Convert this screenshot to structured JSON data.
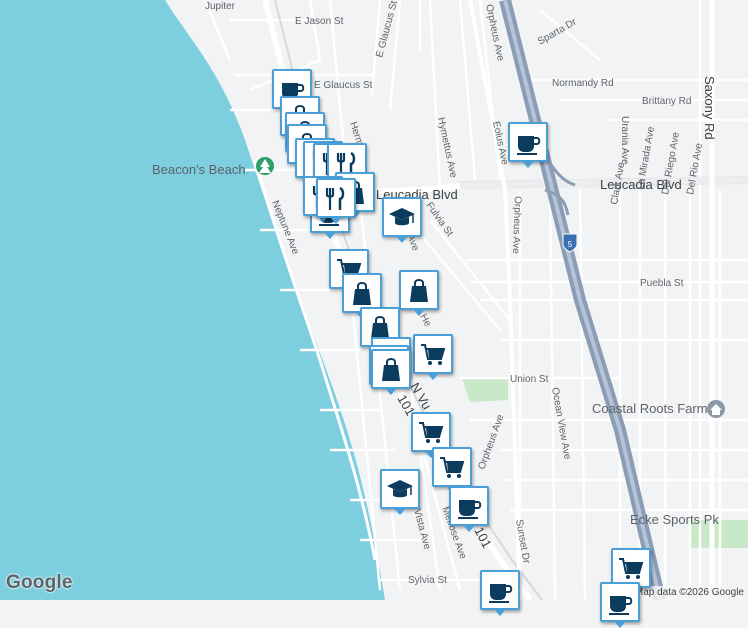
{
  "map": {
    "attribution": "Map data ©2026 Google",
    "logo_text": "Google",
    "colors": {
      "water": "#7dcfe0",
      "land": "#f1f3f4",
      "road": "#ffffff",
      "freeway": "#8a9db5",
      "park": "#c9e8c8",
      "marker_border": "#4a9fd8",
      "icon_fill": "#0b3c5d"
    },
    "streets": {
      "jupiter": "Jupiter",
      "e_jason": "E Jason St",
      "e_glaucus_diag": "E Glaucus St",
      "e_glaucus": "E Glaucus St",
      "orpheus_top": "Orpheus Ave",
      "sparta": "Sparta Dr",
      "normandy": "Normandy Rd",
      "brittany": "Brittany Rd",
      "saxony": "Saxony Rd",
      "hymettus": "Hymettus Ave",
      "eolus": "Eolus Ave",
      "hermes_top": "Herm",
      "leucadia_left": "Leucadia Blvd",
      "leucadia_right": "Leucadia Blvd",
      "urania": "Urania Ave",
      "fulvia": "Fulvia St",
      "neptune": "Neptune Ave",
      "vulcan": "ia Ave",
      "orpheus_mid": "Orpheus Ave",
      "clark": "Clark Ave",
      "la_mirada": "La Mirada Ave",
      "del_riego": "Del Riego Ave",
      "del_rio": "Del Rio Ave",
      "puebla": "Puebla St",
      "hermes_mid": "He",
      "union": "Union St",
      "ocean_view": "Ocean View Ave",
      "hwy_101": "101",
      "n_vulcan": "N Vu",
      "orpheus_low": "Orpheus Ave",
      "sunset": "Sunset Dr",
      "vista": "Vista Ave",
      "melrose": "Melrose Ave",
      "hwy_101_low": "101",
      "sylvia": "Sylvia St",
      "i5_shield": "5"
    },
    "places": {
      "beacons_beach": "Beacon's Beach",
      "coastal_roots_farm": "Coastal Roots Farm",
      "ecke_sports_park": "Ecke Sports Pk"
    },
    "markers": [
      {
        "type": "cafe"
      },
      {
        "type": "shopping"
      },
      {
        "type": "shopping"
      },
      {
        "type": "shopping"
      },
      {
        "type": "restaurant"
      },
      {
        "type": "restaurant"
      },
      {
        "type": "restaurant"
      },
      {
        "type": "restaurant"
      },
      {
        "type": "shopping"
      },
      {
        "type": "cafe"
      },
      {
        "type": "school"
      },
      {
        "type": "restaurant"
      },
      {
        "type": "restaurant"
      },
      {
        "type": "grocery"
      },
      {
        "type": "shopping"
      },
      {
        "type": "shopping"
      },
      {
        "type": "shopping"
      },
      {
        "type": "grocery"
      },
      {
        "type": "shopping"
      },
      {
        "type": "shopping"
      },
      {
        "type": "shopping"
      },
      {
        "type": "grocery"
      },
      {
        "type": "grocery"
      },
      {
        "type": "school"
      },
      {
        "type": "cafe"
      },
      {
        "type": "cafe"
      },
      {
        "type": "grocery"
      },
      {
        "type": "cafe"
      },
      {
        "type": "cafe"
      }
    ]
  }
}
